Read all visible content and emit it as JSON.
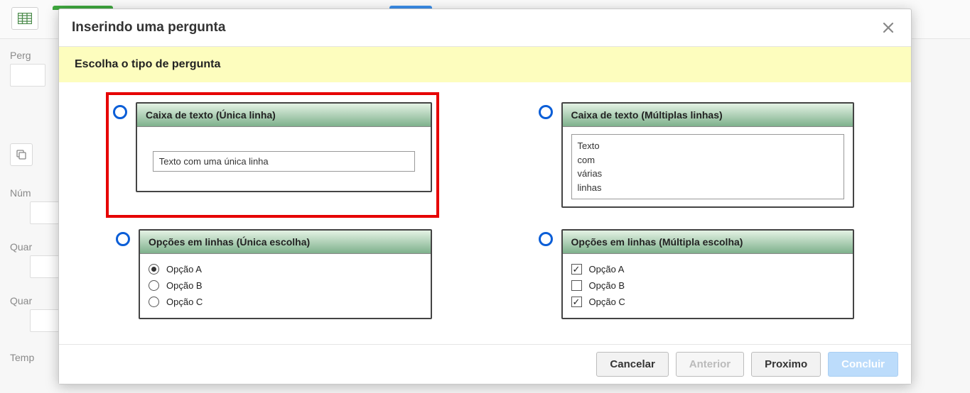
{
  "background": {
    "labels": {
      "pergunta": "Perg",
      "numero": "Núm",
      "quantidade1": "Quar",
      "quantidade2": "Quar",
      "tempo": "Temp"
    }
  },
  "modal": {
    "title": "Inserindo uma pergunta",
    "banner": "Escolha o tipo de pergunta",
    "options": {
      "single_line": {
        "title": "Caixa de texto (Única linha)",
        "sample_value": "Texto com uma única linha"
      },
      "multi_line": {
        "title": "Caixa de texto (Múltiplas linhas)",
        "sample_value": "Texto\ncom\nvárias\nlinhas"
      },
      "radio": {
        "title": "Opções em linhas (Única escolha)",
        "opts": [
          "Opção A",
          "Opção B",
          "Opção C"
        ],
        "checked_index": 0
      },
      "checkbox": {
        "title": "Opções em linhas (Múltipla escolha)",
        "opts": [
          "Opção A",
          "Opção B",
          "Opção C"
        ],
        "checked": [
          true,
          false,
          true
        ]
      }
    },
    "footer": {
      "cancel": "Cancelar",
      "prev": "Anterior",
      "next": "Proximo",
      "finish": "Concluir"
    }
  }
}
